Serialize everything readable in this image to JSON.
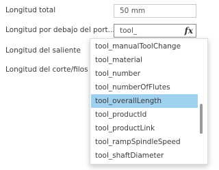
{
  "properties": {
    "total_length": {
      "label": "Longitud total",
      "value": "50 mm"
    },
    "length_below_holder": {
      "label": "Longitud por debajo del port...",
      "value": "tool_"
    },
    "shoulder_length": {
      "label": "Longitud del saliente"
    },
    "flute_length": {
      "label": "Longitud del corte/filos"
    }
  },
  "fx_label": "fx",
  "autocomplete": {
    "items": [
      "tool_manualToolChange",
      "tool_material",
      "tool_number",
      "tool_numberOfFlutes",
      "tool_overallLength",
      "tool_productId",
      "tool_productLink",
      "tool_rampSpindleSpeed",
      "tool_shaftDiameter"
    ],
    "selected": "tool_overallLength",
    "highlight_color": "#9fd0ee"
  }
}
